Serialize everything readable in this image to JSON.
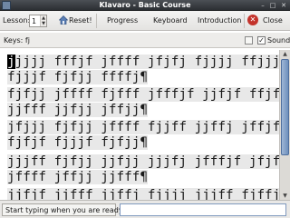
{
  "window": {
    "title": "Klavaro - Basic Course"
  },
  "toolbar": {
    "lesson_label": "Lesson:",
    "lesson_value": "1",
    "reset_label": "Reset!",
    "progress_label": "Progress",
    "keyboard_label": "Keyboard",
    "introduction_label": "Introduction",
    "close_label": "Close"
  },
  "keysbar": {
    "keys_text": "Keys: fj",
    "sound_label": "Sound",
    "sound_checked": true
  },
  "text": {
    "cursor_char": "j",
    "paragraphs": [
      {
        "lines": [
          "jjjj fffjf jffff jfjfj fjjjj ffjjj",
          "fjjjf fjfjj ffffj¶"
        ]
      },
      {
        "lines": [
          "fjfjj jffff fjfff jfffjf jjfjf ffjfj",
          "jjfff jjfjj jffjj¶"
        ]
      },
      {
        "lines": [
          "jfjjj fjfjj jffff fjjff jjffj jffjf",
          "fjfjf fjjjf fjfjj¶"
        ]
      },
      {
        "lines": [
          "jjjff fjfjj jjfjj jjjfj jfffjf jfjff",
          "jffff jffjj jjfff¶"
        ]
      },
      {
        "lines": [
          "jjfjf jjfff jjffj fjjjj jjjff fjffj"
        ]
      }
    ]
  },
  "status": {
    "message": "Start typing when you are ready.",
    "input_value": ""
  },
  "colors": {
    "accent": "#4f6f9e",
    "close_red": "#c3332b"
  }
}
